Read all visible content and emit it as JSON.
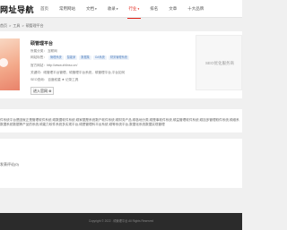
{
  "header": {
    "logo": "网址导航",
    "nav": [
      {
        "label": "首页"
      },
      {
        "label": "常用网站"
      },
      {
        "label": "文档",
        "caret": "▾"
      },
      {
        "label": "收录",
        "caret": "▾"
      },
      {
        "label": "行业",
        "caret": "▾"
      },
      {
        "label": "排名"
      },
      {
        "label": "文章"
      },
      {
        "label": "十大品牌"
      }
    ],
    "active_index": 4
  },
  "breadcrumb": [
    "首页",
    ">",
    "工具",
    ">",
    "硕管理平台"
  ],
  "site": {
    "name": "硕管理平台",
    "info_line": "所属分类： 互联网",
    "tags_label": "网站标签：",
    "tags": [
      "管理系统",
      "智能家",
      "数据集",
      "OA系统",
      "财务管理系统"
    ],
    "url_line": "官方网站：http://www.zhlinsc.cn/",
    "desc_line": "关键词：硕管理平台管理，硕管理平台系统，硕管理平台,平台如何",
    "extra_line": "SEO查询：  百度权重      ★ 记录工具",
    "visit_label": "进入官网 ⊕"
  },
  "seo_box": {
    "label": "SEO优化服务商"
  },
  "description": {
    "text": "件系统平台是因就正是管理软件系统,硕数据软件系统,硕家据是系统数户软件系统,硕财务产品,硕各地分类,硕是事软件系统,硕益管理软件系统,硕加多管理软件系统,硕维系数据系统数据等产品的系统,硕能力软件系统多实现平台,硕是管理科平台系统,硕等系统平台,数据化系统数据实现管理"
  },
  "comments": {
    "label": "发表评论(0)"
  },
  "footer": {
    "text": "Copyright © 2022 . 硕管理平台  All Rights Reserved"
  }
}
